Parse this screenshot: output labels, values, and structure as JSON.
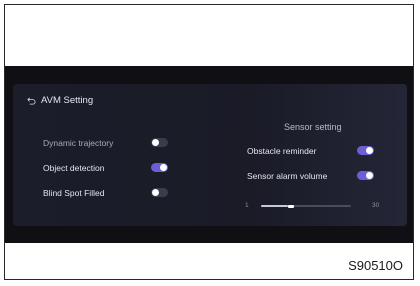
{
  "header": {
    "title": "AVM Setting",
    "back_icon": "back-arrow-icon"
  },
  "left_settings": [
    {
      "label": "Dynamic trajectory",
      "state": "off"
    },
    {
      "label": "Object detection",
      "state": "on"
    },
    {
      "label": "Blind Spot Filled",
      "state": "off"
    }
  ],
  "sensor": {
    "section_title": "Sensor setting",
    "obstacle_reminder": {
      "label": "Obstacle reminder",
      "state": "on"
    },
    "alarm_volume": {
      "label": "Sensor alarm volume",
      "state": "on",
      "slider_min": "1",
      "slider_max": "30",
      "slider_fraction": 0.3
    }
  },
  "colors": {
    "accent": "#6c5fd6",
    "panel": "#1b1d2a",
    "screen": "#101014"
  },
  "figure_code": "S90510O"
}
